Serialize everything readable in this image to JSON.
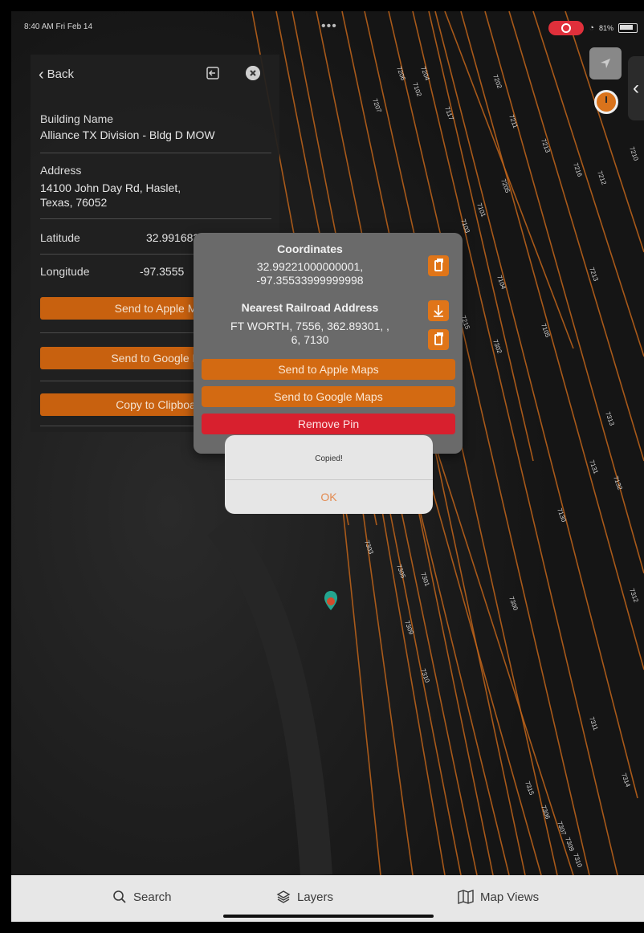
{
  "status_bar": {
    "time": "8:40 AM  Fri Feb 14",
    "dots": "•••",
    "battery": "81%"
  },
  "panel": {
    "back_label": "Back",
    "building_name_label": "Building Name",
    "building_name_value": "Alliance TX Division - Bldg D MOW",
    "address_label": "Address",
    "address_line1": "14100 John Day Rd, Haslet,",
    "address_line2": "Texas, 76052",
    "latitude_label": "Latitude",
    "latitude_value": "32.99168399701958",
    "longitude_label": "Longitude",
    "longitude_value": "-97.3555",
    "apple_maps_btn": "Send to Apple M",
    "google_maps_btn": "Send to Google N",
    "clipboard_btn": "Copy to Clipboa"
  },
  "popup": {
    "coordinates_title": "Coordinates",
    "coordinates_line1": "32.99221000000001,",
    "coordinates_line2": "-97.35533999999998",
    "railroad_title": "Nearest Railroad Address",
    "railroad_line1": "FT WORTH, 7556, 362.89301, ,",
    "railroad_line2": "6, 7130",
    "apple_maps_btn": "Send to Apple Maps",
    "google_maps_btn": "Send to Google Maps",
    "remove_pin_btn": "Remove Pin"
  },
  "alert": {
    "message": "Copied!",
    "ok_label": "OK"
  },
  "tabbar": {
    "search": "Search",
    "layers": "Layers",
    "map_views": "Map Views"
  },
  "map": {
    "track_color": "#c2651a",
    "track_labels": [
      "7206",
      "7102",
      "7204",
      "7117",
      "7207",
      "7202",
      "7211",
      "7213",
      "7216",
      "7212",
      "7210",
      "7205",
      "7101",
      "7103",
      "7104",
      "7105",
      "7213",
      "7215",
      "7302",
      "7130",
      "7131",
      "7132",
      "7303",
      "7305",
      "7301",
      "7300",
      "7309",
      "7310",
      "7311",
      "7315",
      "7306",
      "7307",
      "7309",
      "7310",
      "7314",
      "7313",
      "7312"
    ]
  }
}
